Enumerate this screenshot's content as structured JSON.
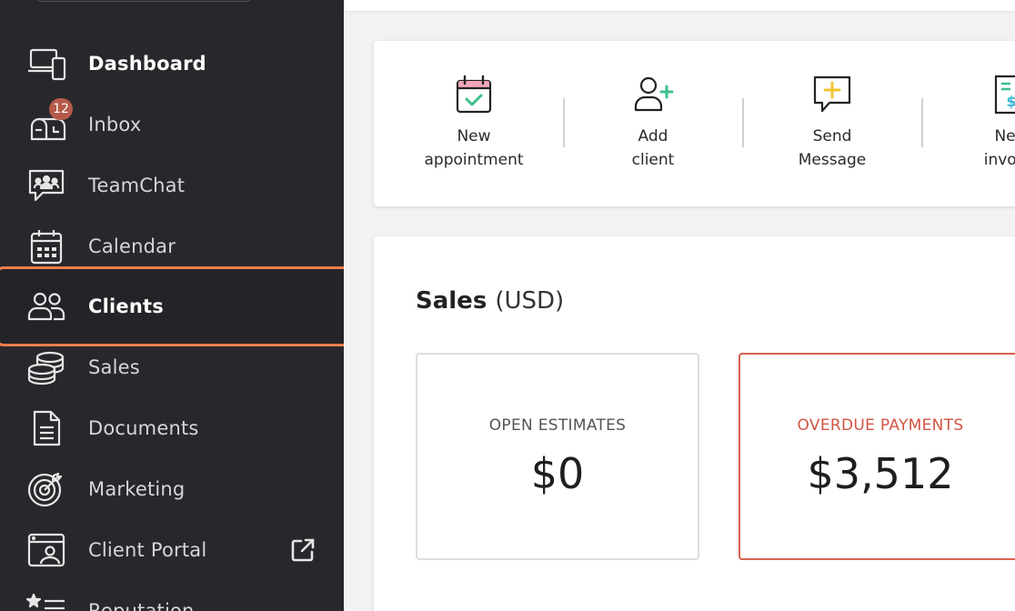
{
  "sidebar": {
    "items": [
      {
        "label": "Dashboard",
        "icon": "devices-icon"
      },
      {
        "label": "Inbox",
        "icon": "mailbox-icon",
        "badge": "12"
      },
      {
        "label": "TeamChat",
        "icon": "team-chat-icon"
      },
      {
        "label": "Calendar",
        "icon": "calendar-icon"
      },
      {
        "label": "Clients",
        "icon": "users-icon",
        "active": true
      },
      {
        "label": "Sales",
        "icon": "coins-icon"
      },
      {
        "label": "Documents",
        "icon": "document-icon"
      },
      {
        "label": "Marketing",
        "icon": "target-icon"
      },
      {
        "label": "Client Portal",
        "icon": "portal-icon",
        "external_icon": "external-link-icon"
      },
      {
        "label": "Reputation",
        "icon": "star-list-icon"
      }
    ],
    "highlight_color": "#ef7d4b"
  },
  "quick_actions": [
    {
      "label": "New\nappointment",
      "icon": "calendar-check-icon"
    },
    {
      "label": "Add\nclient",
      "icon": "add-user-icon"
    },
    {
      "label": "Send\nMessage",
      "icon": "message-plus-icon"
    },
    {
      "label": "New\ninvoice",
      "icon": "invoice-icon"
    }
  ],
  "sales": {
    "title": "Sales",
    "unit": "(USD)",
    "open_estimates": {
      "label": "OPEN ESTIMATES",
      "value": "$0"
    },
    "overdue_payments": {
      "label": "OVERDUE PAYMENTS",
      "value": "$3,512",
      "color": "#d35444"
    }
  }
}
